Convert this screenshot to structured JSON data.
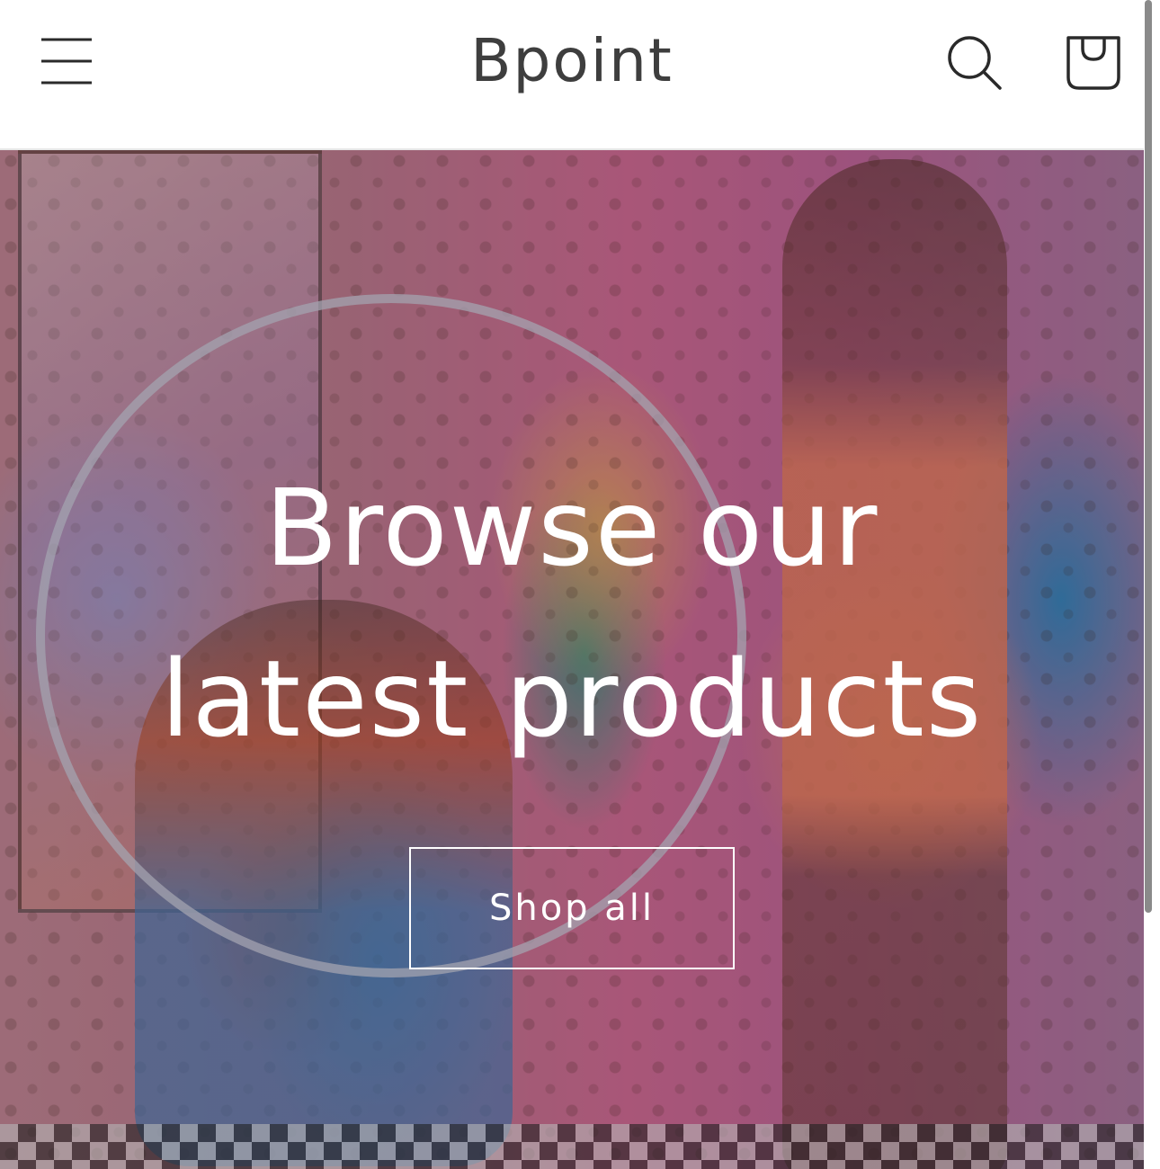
{
  "header": {
    "brand": "Bpoint",
    "icons": {
      "menu": "hamburger-menu-icon",
      "search": "search-icon",
      "cart": "shopping-bag-icon"
    }
  },
  "hero": {
    "heading_line1": "Browse our",
    "heading_line2": "latest products",
    "cta_label": "Shop all"
  },
  "colors": {
    "brand_text": "#3e3e3e",
    "hero_text": "#ffffff",
    "header_bg": "#ffffff"
  }
}
